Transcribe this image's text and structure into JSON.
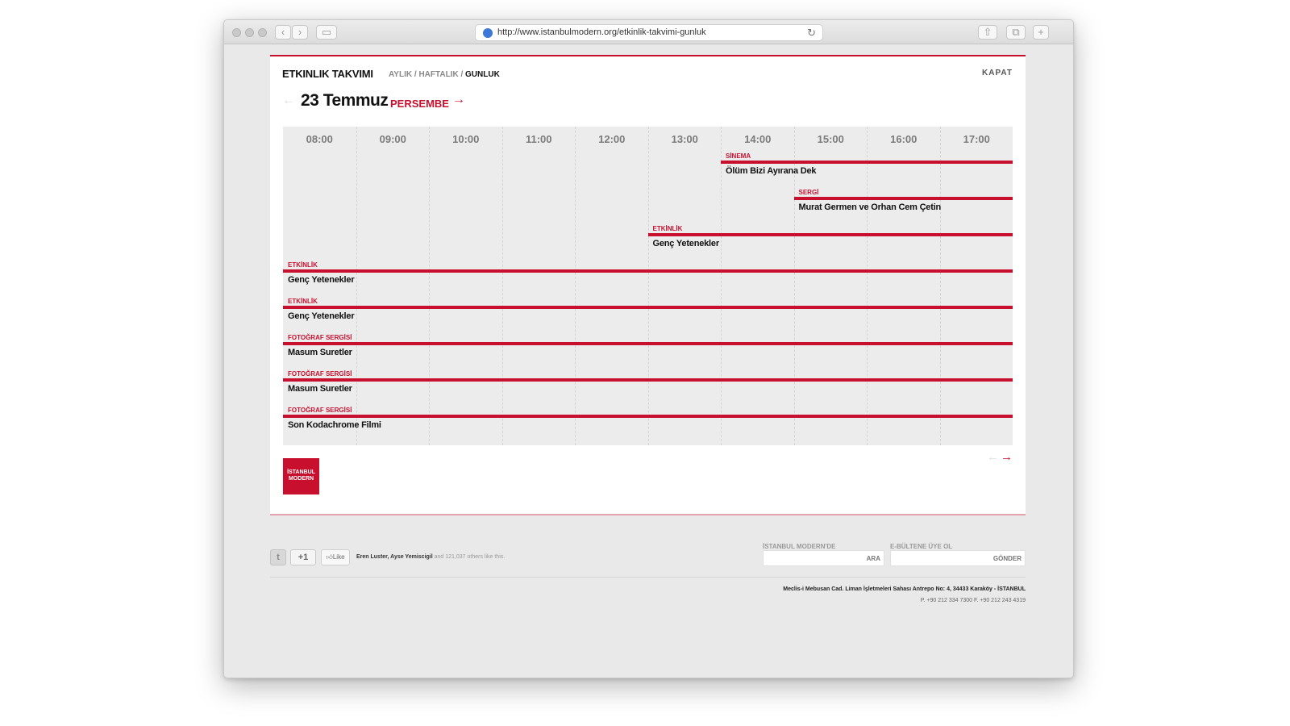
{
  "browser": {
    "url": "http://www.istanbulmodern.org/etkinlik-takvimi-gunluk"
  },
  "calendar": {
    "title": "ETKINLIK TAKVIMI",
    "views": {
      "monthly": "AYLIK",
      "separator1": " / ",
      "weekly": "HAFTALIK",
      "separator2": " / ",
      "daily": "GUNLUK"
    },
    "close_label": "KAPAT",
    "date": "23 Temmuz",
    "weekday": "PERSEMBE",
    "prev_icon": "arrow-left-icon",
    "next_icon": "arrow-right-icon",
    "hours": [
      "08:00",
      "09:00",
      "10:00",
      "11:00",
      "12:00",
      "13:00",
      "14:00",
      "15:00",
      "16:00",
      "17:00"
    ],
    "events": [
      {
        "category": "SİNEMA",
        "name": "Ölüm Bizi Ayırana Dek",
        "start_hour": "14:00"
      },
      {
        "category": "SERGİ",
        "name": "Murat Germen ve Orhan Cem Çetin",
        "start_hour": "15:00"
      },
      {
        "category": "ETKİNLİK",
        "name": "Genç Yetenekler",
        "start_hour": "13:00"
      },
      {
        "category": "ETKİNLİK",
        "name": "Genç Yetenekler",
        "start_hour": "08:00"
      },
      {
        "category": "ETKİNLİK",
        "name": "Genç Yetenekler",
        "start_hour": "08:00"
      },
      {
        "category": "FOTOĞRAF SERGİSİ",
        "name": "Masum Suretler",
        "start_hour": "08:00"
      },
      {
        "category": "FOTOĞRAF SERGİSİ",
        "name": "Masum Suretler",
        "start_hour": "08:00"
      },
      {
        "category": "FOTOĞRAF SERGİSİ",
        "name": "Son Kodachrome Filmi",
        "start_hour": "08:00"
      }
    ],
    "logo_line1": "İSTANBUL",
    "logo_line2": "MODERN"
  },
  "footer": {
    "gplus_label": "+1",
    "like_label": "Like",
    "social_names": "Eren Luster, Ayse Yemiscigil",
    "social_rest": " and 121,037 others like this.",
    "search_label": "İSTANBUL MODERN'DE",
    "search_button": "ARA",
    "newsletter_label": "E-BÜLTENE ÜYE OL",
    "newsletter_button": "GÖNDER",
    "address": "Meclis-i Mebusan Cad. Liman İşletmeleri Sahası Antrepo No: 4, 34433 Karaköy - İSTANBUL",
    "phones": "P. +90 212 334 7300     F. +90 212 243 4319"
  },
  "colors": {
    "accent": "#c8102e",
    "grid_bg": "#ececec",
    "window_bg": "#e9e9e9"
  }
}
